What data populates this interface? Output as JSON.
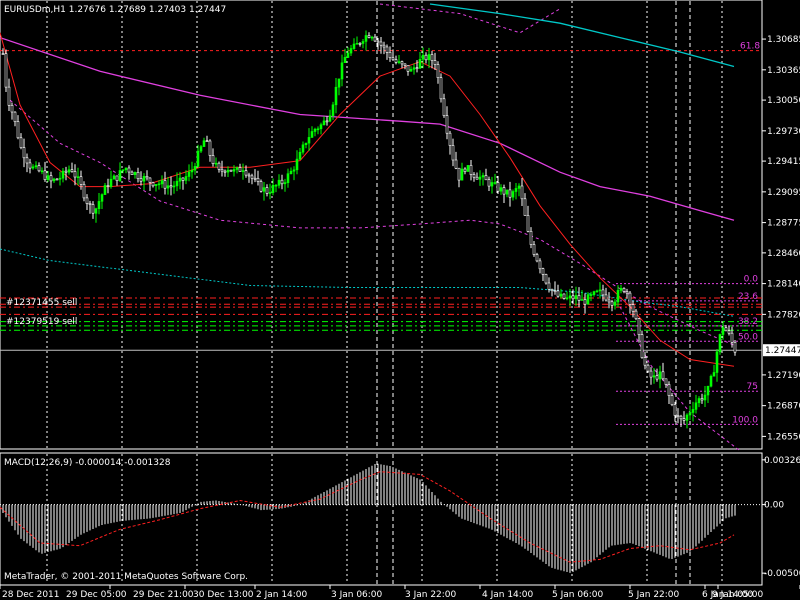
{
  "header": {
    "title": "EURUSDm,H1  1.27676 1.27689 1.27403 1.27447"
  },
  "macd_header": "MACD(12,26,9) -0.000014 -0.001328",
  "copyright": "MetaTrader, © 2001-2011 MetaQuotes Software Corp.",
  "colors": {
    "background": "#000000",
    "bull_candle": "#00ff00",
    "bear_candle": "#ffffff",
    "ma_fast": "#ff2020",
    "ma_slow": "#e040e0",
    "ma_long": "#00c8c8",
    "fib": "#e040e0",
    "order_red": "#ff2020",
    "order_green": "#00ff00",
    "grid": "#ffffff",
    "macd_hist": "#ffffff",
    "macd_signal": "#ff2020"
  },
  "chart_data": {
    "type": "candlestick",
    "symbol": "EURUSDm",
    "timeframe": "H1",
    "price_axis": {
      "ticks": [
        "1.30685",
        "1.30365",
        "1.30050",
        "1.29730",
        "1.29415",
        "1.29095",
        "1.28775",
        "1.28460",
        "1.28140",
        "1.27820",
        "1.27190",
        "1.26870",
        "1.26550"
      ],
      "current": "1.27447",
      "ylim": [
        1.2645,
        1.3105
      ]
    },
    "time_axis": {
      "labels": [
        "28 Dec 2011",
        "29 Dec 05:00",
        "29 Dec 21:00",
        "30 Dec 13:00",
        "2 Jan 14:00",
        "3 Jan 06:00",
        "3 Jan 22:00",
        "4 Jan 14:00",
        "5 Jan 06:00",
        "5 Jan 22:00",
        "6 Jan 14:00",
        "9 Jan 05:00"
      ]
    },
    "price_path": [
      [
        0,
        1.3075
      ],
      [
        6,
        1.301
      ],
      [
        12,
        1.299
      ],
      [
        20,
        1.2955
      ],
      [
        30,
        1.2935
      ],
      [
        40,
        1.293
      ],
      [
        50,
        1.292
      ],
      [
        60,
        1.2925
      ],
      [
        70,
        1.2935
      ],
      [
        80,
        1.2915
      ],
      [
        88,
        1.2895
      ],
      [
        94,
        1.289
      ],
      [
        100,
        1.2905
      ],
      [
        108,
        1.292
      ],
      [
        116,
        1.2925
      ],
      [
        124,
        1.2935
      ],
      [
        132,
        1.293
      ],
      [
        140,
        1.2925
      ],
      [
        150,
        1.292
      ],
      [
        160,
        1.2918
      ],
      [
        170,
        1.2915
      ],
      [
        180,
        1.292
      ],
      [
        190,
        1.293
      ],
      [
        198,
        1.295
      ],
      [
        204,
        1.2965
      ],
      [
        210,
        1.2945
      ],
      [
        218,
        1.293
      ],
      [
        226,
        1.2935
      ],
      [
        234,
        1.293
      ],
      [
        242,
        1.2935
      ],
      [
        250,
        1.2925
      ],
      [
        258,
        1.2915
      ],
      [
        266,
        1.291
      ],
      [
        274,
        1.2915
      ],
      [
        282,
        1.292
      ],
      [
        290,
        1.293
      ],
      [
        298,
        1.2945
      ],
      [
        306,
        1.2965
      ],
      [
        314,
        1.2975
      ],
      [
        322,
        1.298
      ],
      [
        330,
        1.2995
      ],
      [
        338,
        1.303
      ],
      [
        346,
        1.3055
      ],
      [
        354,
        1.306
      ],
      [
        362,
        1.307
      ],
      [
        370,
        1.3075
      ],
      [
        378,
        1.3065
      ],
      [
        386,
        1.3055
      ],
      [
        394,
        1.3045
      ],
      [
        402,
        1.304
      ],
      [
        410,
        1.3035
      ],
      [
        418,
        1.3045
      ],
      [
        426,
        1.305
      ],
      [
        434,
        1.3045
      ],
      [
        440,
        1.301
      ],
      [
        446,
        1.2975
      ],
      [
        452,
        1.2945
      ],
      [
        458,
        1.2925
      ],
      [
        464,
        1.2935
      ],
      [
        470,
        1.293
      ],
      [
        478,
        1.2925
      ],
      [
        486,
        1.292
      ],
      [
        494,
        1.2915
      ],
      [
        502,
        1.291
      ],
      [
        510,
        1.2905
      ],
      [
        518,
        1.2915
      ],
      [
        522,
        1.2895
      ],
      [
        528,
        1.286
      ],
      [
        534,
        1.2845
      ],
      [
        540,
        1.283
      ],
      [
        546,
        1.2815
      ],
      [
        552,
        1.2805
      ],
      [
        558,
        1.28
      ],
      [
        566,
        1.2798
      ],
      [
        574,
        1.28
      ],
      [
        582,
        1.2795
      ],
      [
        590,
        1.28
      ],
      [
        598,
        1.2805
      ],
      [
        606,
        1.28
      ],
      [
        612,
        1.2795
      ],
      [
        618,
        1.2805
      ],
      [
        624,
        1.281
      ],
      [
        628,
        1.28
      ],
      [
        634,
        1.278
      ],
      [
        640,
        1.2745
      ],
      [
        646,
        1.272
      ],
      [
        652,
        1.2715
      ],
      [
        658,
        1.272
      ],
      [
        664,
        1.271
      ],
      [
        670,
        1.269
      ],
      [
        676,
        1.2675
      ],
      [
        682,
        1.267
      ],
      [
        688,
        1.268
      ],
      [
        694,
        1.269
      ],
      [
        700,
        1.2695
      ],
      [
        706,
        1.27
      ],
      [
        712,
        1.272
      ],
      [
        718,
        1.2755
      ],
      [
        722,
        1.277
      ],
      [
        728,
        1.276
      ],
      [
        734,
        1.2745
      ]
    ],
    "ma_fast": [
      [
        0,
        1.3075
      ],
      [
        20,
        1.3
      ],
      [
        50,
        1.294
      ],
      [
        80,
        1.2915
      ],
      [
        110,
        1.2915
      ],
      [
        150,
        1.2918
      ],
      [
        200,
        1.2935
      ],
      [
        250,
        1.2935
      ],
      [
        300,
        1.2942
      ],
      [
        340,
        1.299
      ],
      [
        380,
        1.303
      ],
      [
        420,
        1.3045
      ],
      [
        450,
        1.303
      ],
      [
        480,
        1.299
      ],
      [
        510,
        1.2945
      ],
      [
        540,
        1.2895
      ],
      [
        570,
        1.2855
      ],
      [
        600,
        1.282
      ],
      [
        630,
        1.279
      ],
      [
        660,
        1.2755
      ],
      [
        690,
        1.2735
      ],
      [
        734,
        1.2728
      ]
    ],
    "ma_slow": [
      [
        0,
        1.307
      ],
      [
        100,
        1.3035
      ],
      [
        200,
        1.301
      ],
      [
        300,
        1.299
      ],
      [
        400,
        1.2983
      ],
      [
        440,
        1.298
      ],
      [
        500,
        1.296
      ],
      [
        560,
        1.293
      ],
      [
        600,
        1.2915
      ],
      [
        650,
        1.2905
      ],
      [
        700,
        1.289
      ],
      [
        734,
        1.288
      ]
    ],
    "ma_long": [
      [
        430,
        1.3105
      ],
      [
        500,
        1.3095
      ],
      [
        560,
        1.3085
      ],
      [
        620,
        1.307
      ],
      [
        680,
        1.3055
      ],
      [
        734,
        1.304
      ]
    ],
    "envelope_upper": [
      [
        380,
        1.3105
      ],
      [
        460,
        1.3095
      ],
      [
        520,
        1.3075
      ],
      [
        560,
        1.31
      ]
    ],
    "envelope_mid": [
      [
        10,
        1.3005
      ],
      [
        60,
        1.296
      ],
      [
        100,
        1.294
      ],
      [
        160,
        1.29
      ],
      [
        220,
        1.288
      ],
      [
        300,
        1.2872
      ],
      [
        360,
        1.2872
      ],
      [
        420,
        1.2876
      ],
      [
        470,
        1.288
      ],
      [
        500,
        1.2876
      ],
      [
        540,
        1.286
      ],
      [
        580,
        1.2835
      ],
      [
        610,
        1.2815
      ],
      [
        650,
        1.279
      ],
      [
        700,
        1.2765
      ],
      [
        734,
        1.275
      ]
    ],
    "envelope_lower": [
      [
        0,
        1.285
      ],
      [
        50,
        1.2838
      ],
      [
        150,
        1.2825
      ],
      [
        250,
        1.2812
      ],
      [
        350,
        1.281
      ],
      [
        450,
        1.281
      ],
      [
        520,
        1.281
      ],
      [
        580,
        1.2805
      ],
      [
        640,
        1.2795
      ],
      [
        680,
        1.279
      ],
      [
        734,
        1.278
      ]
    ],
    "envelope_lower2": [
      [
        620,
        1.279
      ],
      [
        650,
        1.273
      ],
      [
        690,
        1.268
      ],
      [
        740,
        1.264
      ]
    ],
    "resistance": {
      "label": "61.8",
      "value": 1.30565
    },
    "order_lines": [
      {
        "label": "#12371455 sell",
        "value": 1.27895,
        "color": "#ff2020"
      },
      {
        "label": "#12379519 sell",
        "value": 1.277,
        "color": "#00ff00"
      }
    ],
    "extra_red_lines": [
      1.2799,
      1.27925,
      1.2782
    ],
    "extra_green_lines": [
      1.27745,
      1.27655
    ],
    "fib_levels": [
      {
        "label": "0.0",
        "value": 1.2814
      },
      {
        "label": "23.6",
        "value": 1.2796
      },
      {
        "label": "38.2",
        "value": 1.277
      },
      {
        "label": "50.0",
        "value": 1.2754
      },
      {
        "label": "75",
        "value": 1.2702
      },
      {
        "label": "100.0",
        "value": 1.26675
      }
    ],
    "vertical_grid_x": [
      47,
      122,
      197,
      272,
      347,
      422,
      497,
      572,
      647,
      722
    ],
    "dashed_verticals_x": [
      377,
      393,
      676,
      690
    ],
    "macd": {
      "axis_ticks": [
        "0.003266",
        "0.00",
        "-0.00500"
      ],
      "ylim": [
        -0.0055,
        0.0034
      ],
      "histogram": [
        [
          0,
          -0.0004
        ],
        [
          20,
          -0.0025
        ],
        [
          40,
          -0.0036
        ],
        [
          60,
          -0.0032
        ],
        [
          80,
          -0.0022
        ],
        [
          100,
          -0.0015
        ],
        [
          120,
          -0.0012
        ],
        [
          150,
          -0.001
        ],
        [
          180,
          -0.0006
        ],
        [
          200,
          0.0002
        ],
        [
          215,
          0.0003
        ],
        [
          240,
          0.0
        ],
        [
          260,
          -0.0004
        ],
        [
          280,
          -0.0003
        ],
        [
          300,
          0.0
        ],
        [
          330,
          0.0012
        ],
        [
          360,
          0.0024
        ],
        [
          375,
          0.003
        ],
        [
          390,
          0.0028
        ],
        [
          420,
          0.0018
        ],
        [
          440,
          0.0002
        ],
        [
          460,
          -0.001
        ],
        [
          490,
          -0.0018
        ],
        [
          520,
          -0.003
        ],
        [
          550,
          -0.0046
        ],
        [
          570,
          -0.005
        ],
        [
          590,
          -0.0042
        ],
        [
          610,
          -0.003
        ],
        [
          630,
          -0.0028
        ],
        [
          650,
          -0.0034
        ],
        [
          670,
          -0.004
        ],
        [
          690,
          -0.0034
        ],
        [
          710,
          -0.002
        ],
        [
          725,
          -0.001
        ],
        [
          734,
          -0.0008
        ]
      ],
      "signal": [
        [
          0,
          -0.0002
        ],
        [
          40,
          -0.0028
        ],
        [
          80,
          -0.003
        ],
        [
          120,
          -0.0018
        ],
        [
          160,
          -0.0011
        ],
        [
          200,
          -0.0003
        ],
        [
          240,
          0.0003
        ],
        [
          280,
          -0.0002
        ],
        [
          320,
          0.0004
        ],
        [
          360,
          0.0018
        ],
        [
          380,
          0.0024
        ],
        [
          420,
          0.0022
        ],
        [
          450,
          0.001
        ],
        [
          490,
          -0.001
        ],
        [
          530,
          -0.0028
        ],
        [
          570,
          -0.0042
        ],
        [
          600,
          -0.004
        ],
        [
          630,
          -0.0032
        ],
        [
          660,
          -0.003
        ],
        [
          690,
          -0.0033
        ],
        [
          720,
          -0.0028
        ],
        [
          734,
          -0.0022
        ]
      ]
    }
  }
}
